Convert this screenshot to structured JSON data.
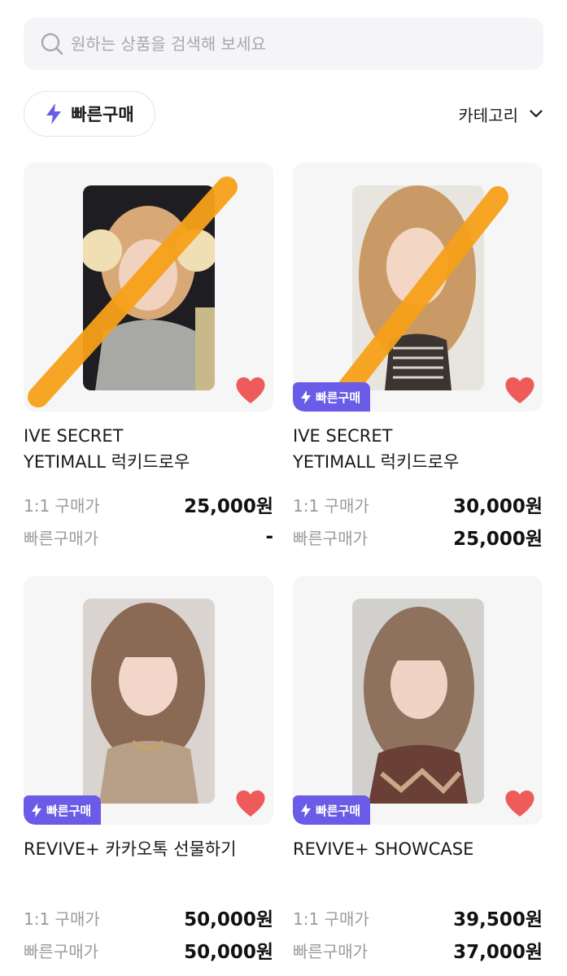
{
  "search": {
    "placeholder": "원하는 상품을 검색해 보세요"
  },
  "toolbar": {
    "quick_buy_label": "빠른구매",
    "category_label": "카테고리"
  },
  "colors": {
    "accent": "#6b5ce7",
    "heart": "#ee5b5b",
    "strike": "#f7a11a"
  },
  "products": [
    {
      "title": "IVE SECRET\nYETIMALL 럭키드로우",
      "one_to_one_label": "1:1 구매가",
      "one_to_one_price": "25,000원",
      "quick_label": "빠른구매가",
      "quick_price": "-",
      "badge": "",
      "sold_out_strike": true,
      "favorited": true
    },
    {
      "title": "IVE SECRET\nYETIMALL 럭키드로우",
      "one_to_one_label": "1:1 구매가",
      "one_to_one_price": "30,000원",
      "quick_label": "빠른구매가",
      "quick_price": "25,000원",
      "badge": "빠른구매",
      "sold_out_strike": true,
      "favorited": true
    },
    {
      "title": "REVIVE+ 카카오톡 선물하기",
      "one_to_one_label": "1:1 구매가",
      "one_to_one_price": "50,000원",
      "quick_label": "빠른구매가",
      "quick_price": "50,000원",
      "badge": "빠른구매",
      "sold_out_strike": false,
      "favorited": true
    },
    {
      "title": "REVIVE+ SHOWCASE",
      "one_to_one_label": "1:1 구매가",
      "one_to_one_price": "39,500원",
      "quick_label": "빠른구매가",
      "quick_price": "37,000원",
      "badge": "빠른구매",
      "sold_out_strike": false,
      "favorited": true
    }
  ]
}
